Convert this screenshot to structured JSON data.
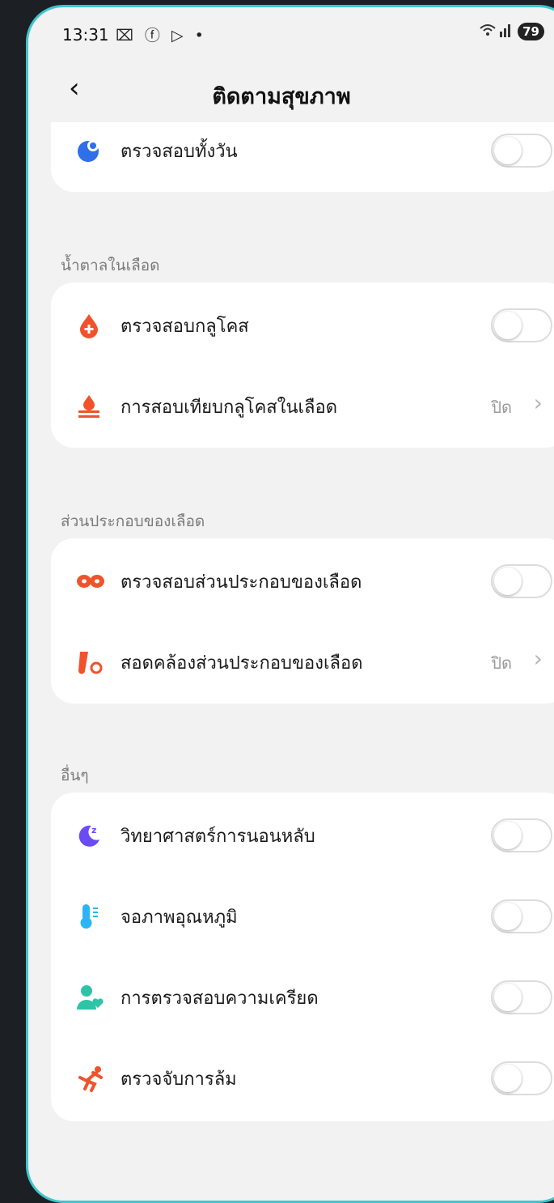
{
  "status": {
    "time": "13:31",
    "icons": "⌧ ⓕ ▷ •",
    "signal": "📶",
    "battery": "79"
  },
  "header": {
    "back_label": "‹",
    "title": "ติดตามสุขภาพ"
  },
  "top_card": {
    "row": {
      "label": "ตรวจสอบทั้งวัน",
      "icon": "water-drop-icon",
      "toggle": false
    }
  },
  "sections": {
    "glucose": {
      "title": "น้ำตาลในเลือด",
      "rows": [
        {
          "label": "ตรวจสอบกลูโคส",
          "icon": "blood-drop-plus-icon",
          "toggle": false
        },
        {
          "label": "การสอบเทียบกลูโคสในเลือด",
          "icon": "calibration-icon",
          "value": "ปิด"
        }
      ]
    },
    "blood": {
      "title": "ส่วนประกอบของเลือด",
      "rows": [
        {
          "label": "ตรวจสอบส่วนประกอบของเลือด",
          "icon": "blood-cells-icon",
          "toggle": false
        },
        {
          "label": "สอดคล้องส่วนประกอบของเลือด",
          "icon": "test-tube-sync-icon",
          "value": "ปิด"
        }
      ]
    },
    "other": {
      "title": "อื่นๆ",
      "rows": [
        {
          "label": "วิทยาศาสตร์การนอนหลับ",
          "icon": "sleep-moon-icon",
          "toggle": false
        },
        {
          "label": "จอภาพอุณหภูมิ",
          "icon": "thermometer-icon",
          "toggle": false
        },
        {
          "label": "การตรวจสอบความเครียด",
          "icon": "stress-person-icon",
          "toggle": false
        },
        {
          "label": "ตรวจจับการล้ม",
          "icon": "fall-detection-icon",
          "toggle": false
        }
      ]
    }
  },
  "colors": {
    "frame": "#3fc6cf",
    "glucose": "#f0532b",
    "blood": "#f0532b",
    "sleep": "#6c4bf5",
    "temp": "#29b6f6",
    "stress": "#2ec4a6",
    "fall": "#f0532b",
    "drop": "#2f6fe8"
  }
}
